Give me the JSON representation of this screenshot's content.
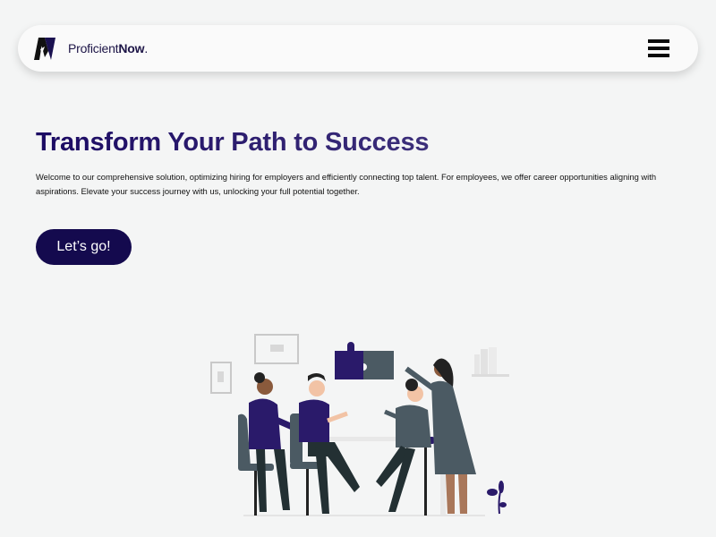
{
  "nav": {
    "brand_prefix": "Proficient",
    "brand_bold": "Now",
    "brand_suffix": "."
  },
  "hero": {
    "title": "Transform Your Path to Success",
    "description": "Welcome to our comprehensive solution, optimizing hiring for employers and efficiently connecting top talent. For employees, we offer career opportunities aligning with aspirations. Elevate your success journey with us, unlocking your full potential together.",
    "cta_label": "Let’s go!"
  },
  "icons": {
    "logo": "proficientnow-logo-icon",
    "menu": "hamburger-menu-icon"
  },
  "colors": {
    "background": "#f4f5f5",
    "navbar": "#fafafa",
    "brand_text": "#1d1547",
    "title_start": "#1b0a63",
    "title_end": "#3c2f7a",
    "cta_bg": "#140a4e",
    "cta_text": "#ffffff",
    "illustration_purple": "#2a1a6a",
    "illustration_slate": "#4b5a63"
  }
}
